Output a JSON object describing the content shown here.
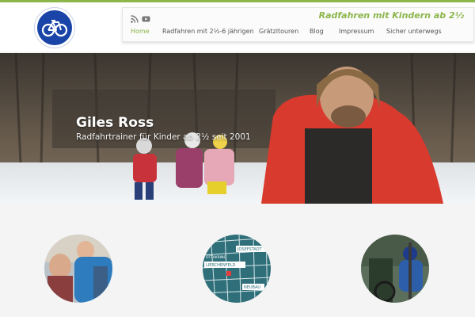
{
  "header": {
    "tagline": "Radfahren mit Kindern ab 2½",
    "nav": [
      {
        "label": "Home",
        "active": true
      },
      {
        "label": "Radfahren mit 2½-6 jährigen",
        "active": false
      },
      {
        "label": "Grätzltouren",
        "active": false
      },
      {
        "label": "Blog",
        "active": false
      },
      {
        "label": "Impressum",
        "active": false
      },
      {
        "label": "Sicher unterwegs",
        "active": false
      }
    ],
    "social": [
      "rss-icon",
      "youtube-icon"
    ]
  },
  "hero": {
    "title": "Giles Ross",
    "subtitle": "Radfahrtrainer für Kinder ab 2½ seit 2001"
  },
  "features": {
    "map_labels": [
      "JOSEFSTADT",
      "OTTAKRING",
      "LIERCHENFELD",
      "NEUBAU"
    ]
  },
  "colors": {
    "accent": "#8cb54a",
    "logo": "#1a44a8"
  }
}
